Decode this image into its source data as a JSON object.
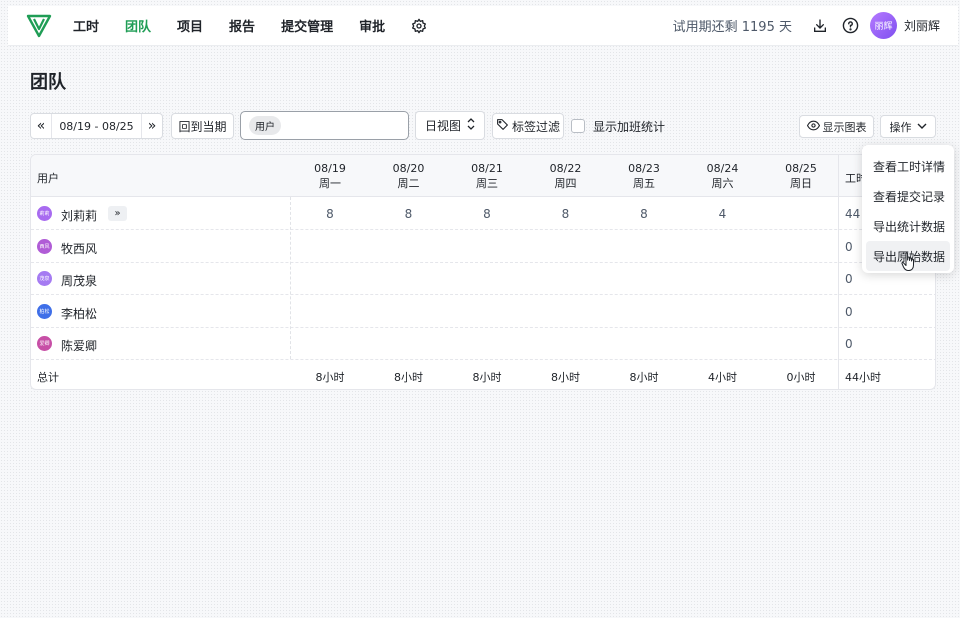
{
  "nav": {
    "menu": [
      "工时",
      "团队",
      "项目",
      "报告",
      "提交管理",
      "审批"
    ],
    "active_index": 1,
    "accent_color": "#1f9d55",
    "settings_icon": "gear-icon",
    "trial_text": "试用期还剩 1195 天",
    "download_icon": "download-icon",
    "help_icon": "help-icon",
    "avatar_text": "丽辉",
    "user_name": "刘丽辉"
  },
  "page": {
    "title": "团队"
  },
  "toolbar": {
    "prev_icon": "double-chevron-left-icon",
    "date_range": "08/19 - 08/25",
    "next_icon": "double-chevron-right-icon",
    "current_period_label": "回到当期",
    "user_filter_chip": "用户",
    "view_select": "日视图",
    "tag_filter_label": "标签过滤",
    "overtime_label": "显示加班统计",
    "show_chart_label": "显示图表",
    "ops_label": "操作"
  },
  "table": {
    "user_header": "用户",
    "days": [
      {
        "date": "08/19",
        "weekday": "周一"
      },
      {
        "date": "08/20",
        "weekday": "周二"
      },
      {
        "date": "08/21",
        "weekday": "周三"
      },
      {
        "date": "08/22",
        "weekday": "周四"
      },
      {
        "date": "08/23",
        "weekday": "周五"
      },
      {
        "date": "08/24",
        "weekday": "周六"
      },
      {
        "date": "08/25",
        "weekday": "周日"
      }
    ],
    "total_header": "工时",
    "rows": [
      {
        "avatar": "莉莉",
        "avatar_color": "#a86bf0",
        "name": "刘莉莉",
        "expand": "»",
        "values": [
          "8",
          "8",
          "8",
          "8",
          "8",
          "4",
          ""
        ],
        "total": "44"
      },
      {
        "avatar": "西风",
        "avatar_color": "#b05cd6",
        "name": "牧西风",
        "values": [
          "",
          "",
          "",
          "",
          "",
          "",
          ""
        ],
        "total": "0"
      },
      {
        "avatar": "茂泉",
        "avatar_color": "#a57bf2",
        "name": "周茂泉",
        "values": [
          "",
          "",
          "",
          "",
          "",
          "",
          ""
        ],
        "total": "0"
      },
      {
        "avatar": "柏松",
        "avatar_color": "#3f6fe8",
        "name": "李柏松",
        "values": [
          "",
          "",
          "",
          "",
          "",
          "",
          ""
        ],
        "total": "0"
      },
      {
        "avatar": "爱卿",
        "avatar_color": "#c74fa6",
        "name": "陈爱卿",
        "values": [
          "",
          "",
          "",
          "",
          "",
          "",
          ""
        ],
        "total": "0"
      }
    ],
    "footer": {
      "label": "总计",
      "values": [
        "8小时",
        "8小时",
        "8小时",
        "8小时",
        "8小时",
        "4小时",
        "0小时"
      ],
      "total": "44小时"
    }
  },
  "ops_menu": {
    "items": [
      "查看工时详情",
      "查看提交记录",
      "导出统计数据",
      "导出原始数据"
    ],
    "hover_index": 3
  }
}
